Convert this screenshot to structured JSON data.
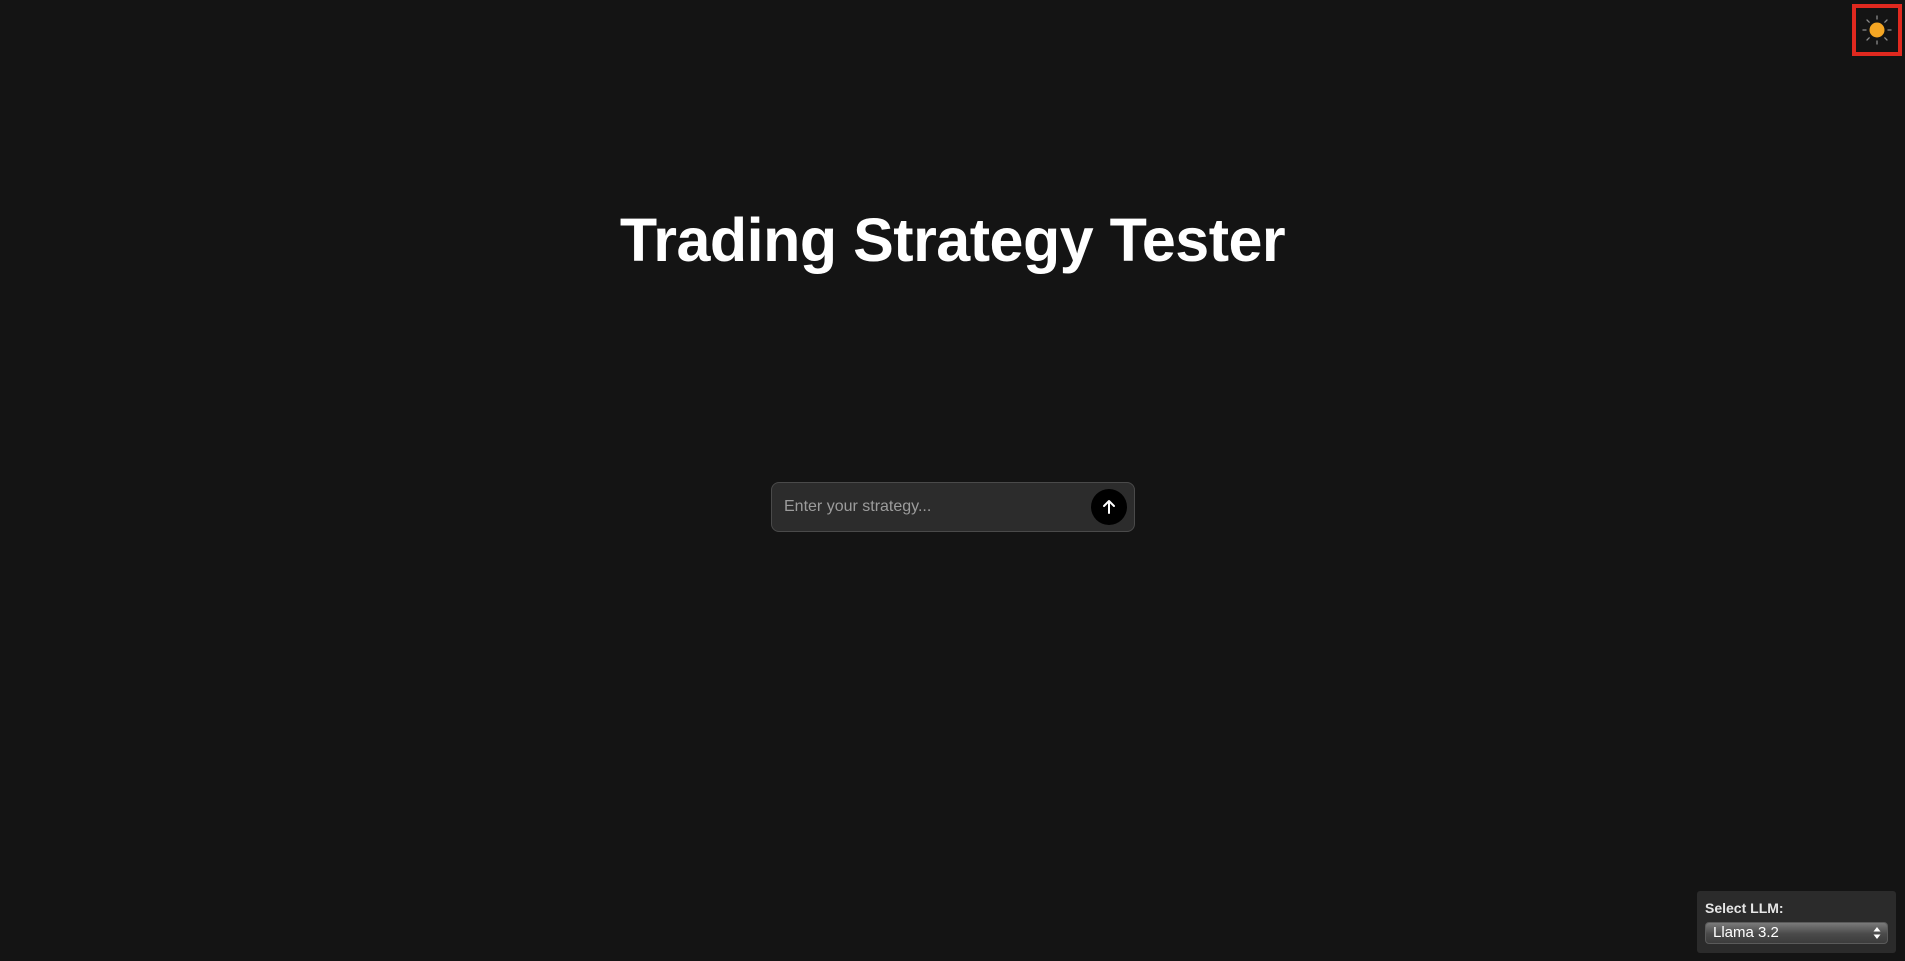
{
  "theme_toggle": {
    "icon": "sun-icon",
    "accent_color": "#f5a623"
  },
  "header": {
    "title": "Trading Strategy Tester"
  },
  "strategy_form": {
    "placeholder": "Enter your strategy...",
    "value": "",
    "submit_icon": "arrow-up-icon"
  },
  "llm_selector": {
    "label": "Select LLM:",
    "selected": "Llama 3.2",
    "icon": "select-arrows-icon"
  }
}
